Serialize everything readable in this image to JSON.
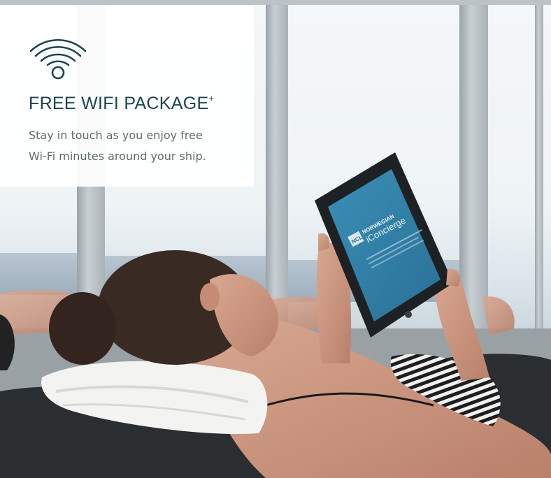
{
  "promo": {
    "title": "FREE WIFI PACKAGE",
    "title_mark": "+",
    "description_line1": "Stay in touch as you enjoy free",
    "description_line2": "Wi-Fi minutes around your ship."
  },
  "tablet_screen": {
    "brand_small": "NCL",
    "brand_name": "NORWEGIAN",
    "app_name": "iConcierge"
  },
  "icons": [
    "wifi-icon"
  ],
  "colors": {
    "title": "#1c4451",
    "icon_stroke": "#1c4451",
    "body_text": "#5e6a70",
    "card_bg": "#ffffff",
    "tablet_screen": "#2f7fa6"
  }
}
